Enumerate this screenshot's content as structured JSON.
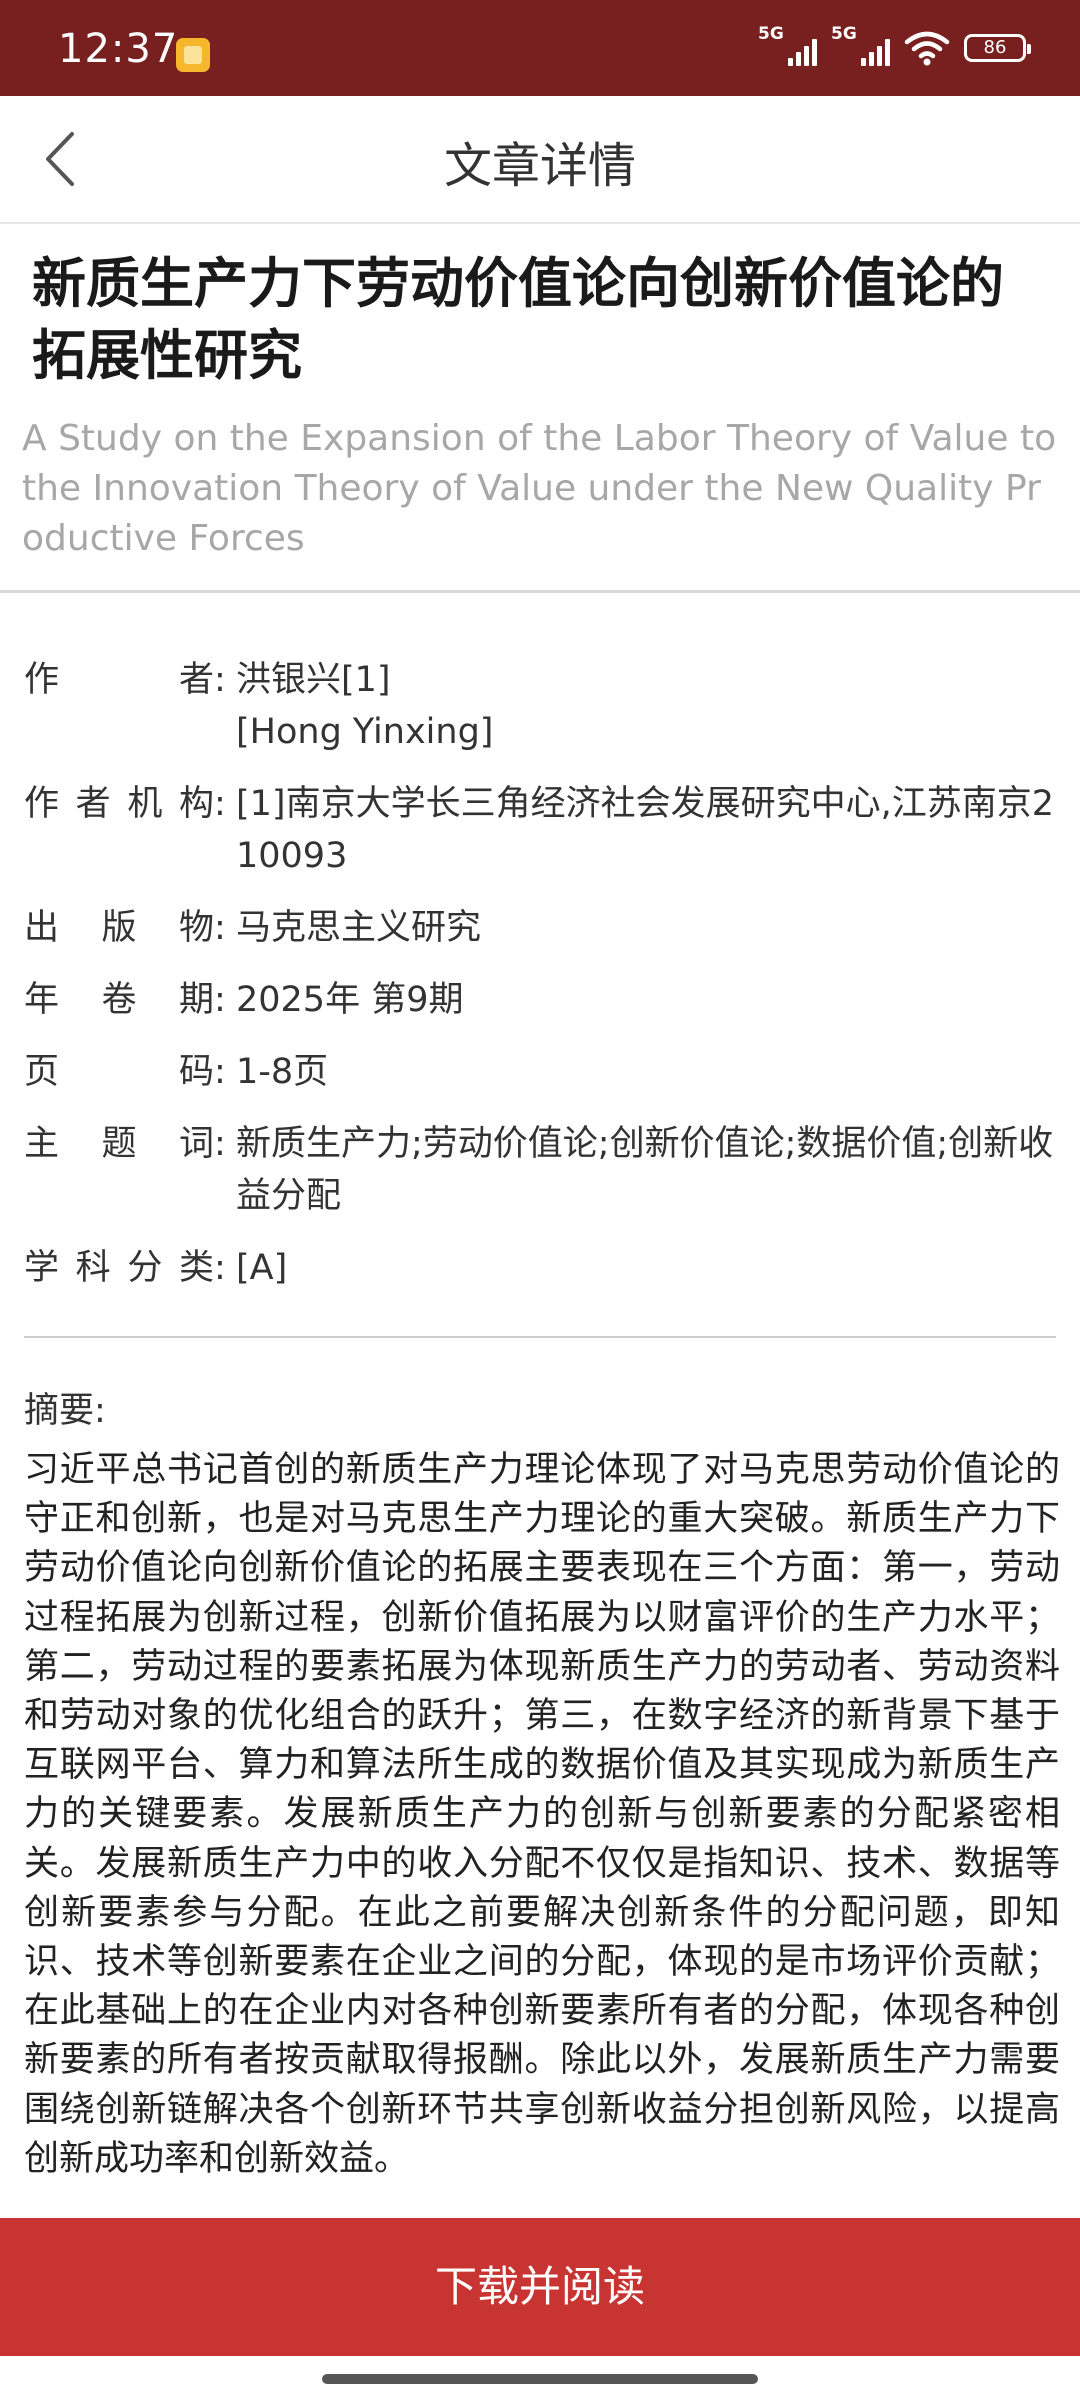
{
  "status_bar": {
    "time": "12:37",
    "net1": "5G",
    "net2": "5G",
    "battery": "86"
  },
  "header": {
    "title": "文章详情"
  },
  "article": {
    "title_cn": "新质生产力下劳动价值论向创新价值论的拓展性研究",
    "title_en": "A Study on the Expansion of the Labor Theory of Value to the Innovation Theory of Value under the New Quality Productive Forces"
  },
  "meta": {
    "author_label": "作者",
    "author_cn": "洪银兴[1]",
    "author_en": "[Hong Yinxing]",
    "affiliation_label": "作者机构",
    "affiliation": "[1]南京大学长三角经济社会发展研究中心,江苏南京210093",
    "publication_label": "出版物",
    "publication": "马克思主义研究",
    "issue_label": "年卷期",
    "issue": "2025年 第9期",
    "pages_label": "页码",
    "pages": "1-8页",
    "keywords_label": "主题词",
    "keywords": "新质生产力;劳动价值论;创新价值论;数据价值;创新收益分配",
    "subject_label": "学科分类",
    "subject": "[A]",
    "colon": ":"
  },
  "abstract": {
    "label": "摘要:",
    "text": "习近平总书记首创的新质生产力理论体现了对马克思劳动价值论的守正和创新，也是对马克思生产力理论的重大突破。新质生产力下劳动价值论向创新价值论的拓展主要表现在三个方面：第一，劳动过程拓展为创新过程，创新价值拓展为以财富评价的生产力水平；第二，劳动过程的要素拓展为体现新质生产力的劳动者、劳动资料和劳动对象的优化组合的跃升；第三，在数字经济的新背景下基于互联网平台、算力和算法所生成的数据价值及其实现成为新质生产力的关键要素。发展新质生产力的创新与创新要素的分配紧密相关。发展新质生产力中的收入分配不仅仅是指知识、技术、数据等创新要素参与分配。在此之前要解决创新条件的分配问题，即知识、技术等创新要素在企业之间的分配，体现的是市场评价贡献；在此基础上的在企业内对各种创新要素所有者的分配，体现各种创新要素的所有者按贡献取得报酬。除此以外，发展新质生产力需要围绕创新链解决各个创新环节共享创新收益分担创新风险，以提高创新成功率和创新效益。"
  },
  "actions": {
    "download_label": "下载并阅读"
  }
}
